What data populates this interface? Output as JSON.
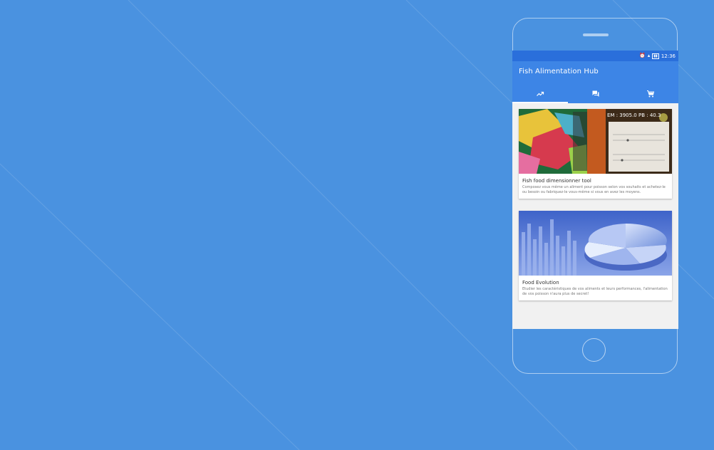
{
  "app": {
    "title": "Fish Alimentation Hub",
    "time": "12:36"
  },
  "tabs": [
    {
      "icon": "trending-up-icon",
      "active": true
    },
    {
      "icon": "forum-icon",
      "active": false
    },
    {
      "icon": "cart-icon",
      "active": false
    }
  ],
  "cards": [
    {
      "title": "Fish food dimensionner tool",
      "description": "Composez vous même un aliment pour poisson selon vos souhaits et achetez-le ou besoin ou fabriquez-le vous-même si vous en avez les moyens.",
      "image_text": "EM : 3905.0  PB : 40.3"
    },
    {
      "title": "Food Evolution",
      "description": "Etudier les caractéristiques de vos aliments et leurs performances, l'alimentation de vos poisson n'aura plus de secret!"
    }
  ],
  "colors": {
    "background": "#4a92e0",
    "status_bar": "#2a6fdb",
    "app_bar": "#3d85e6"
  }
}
